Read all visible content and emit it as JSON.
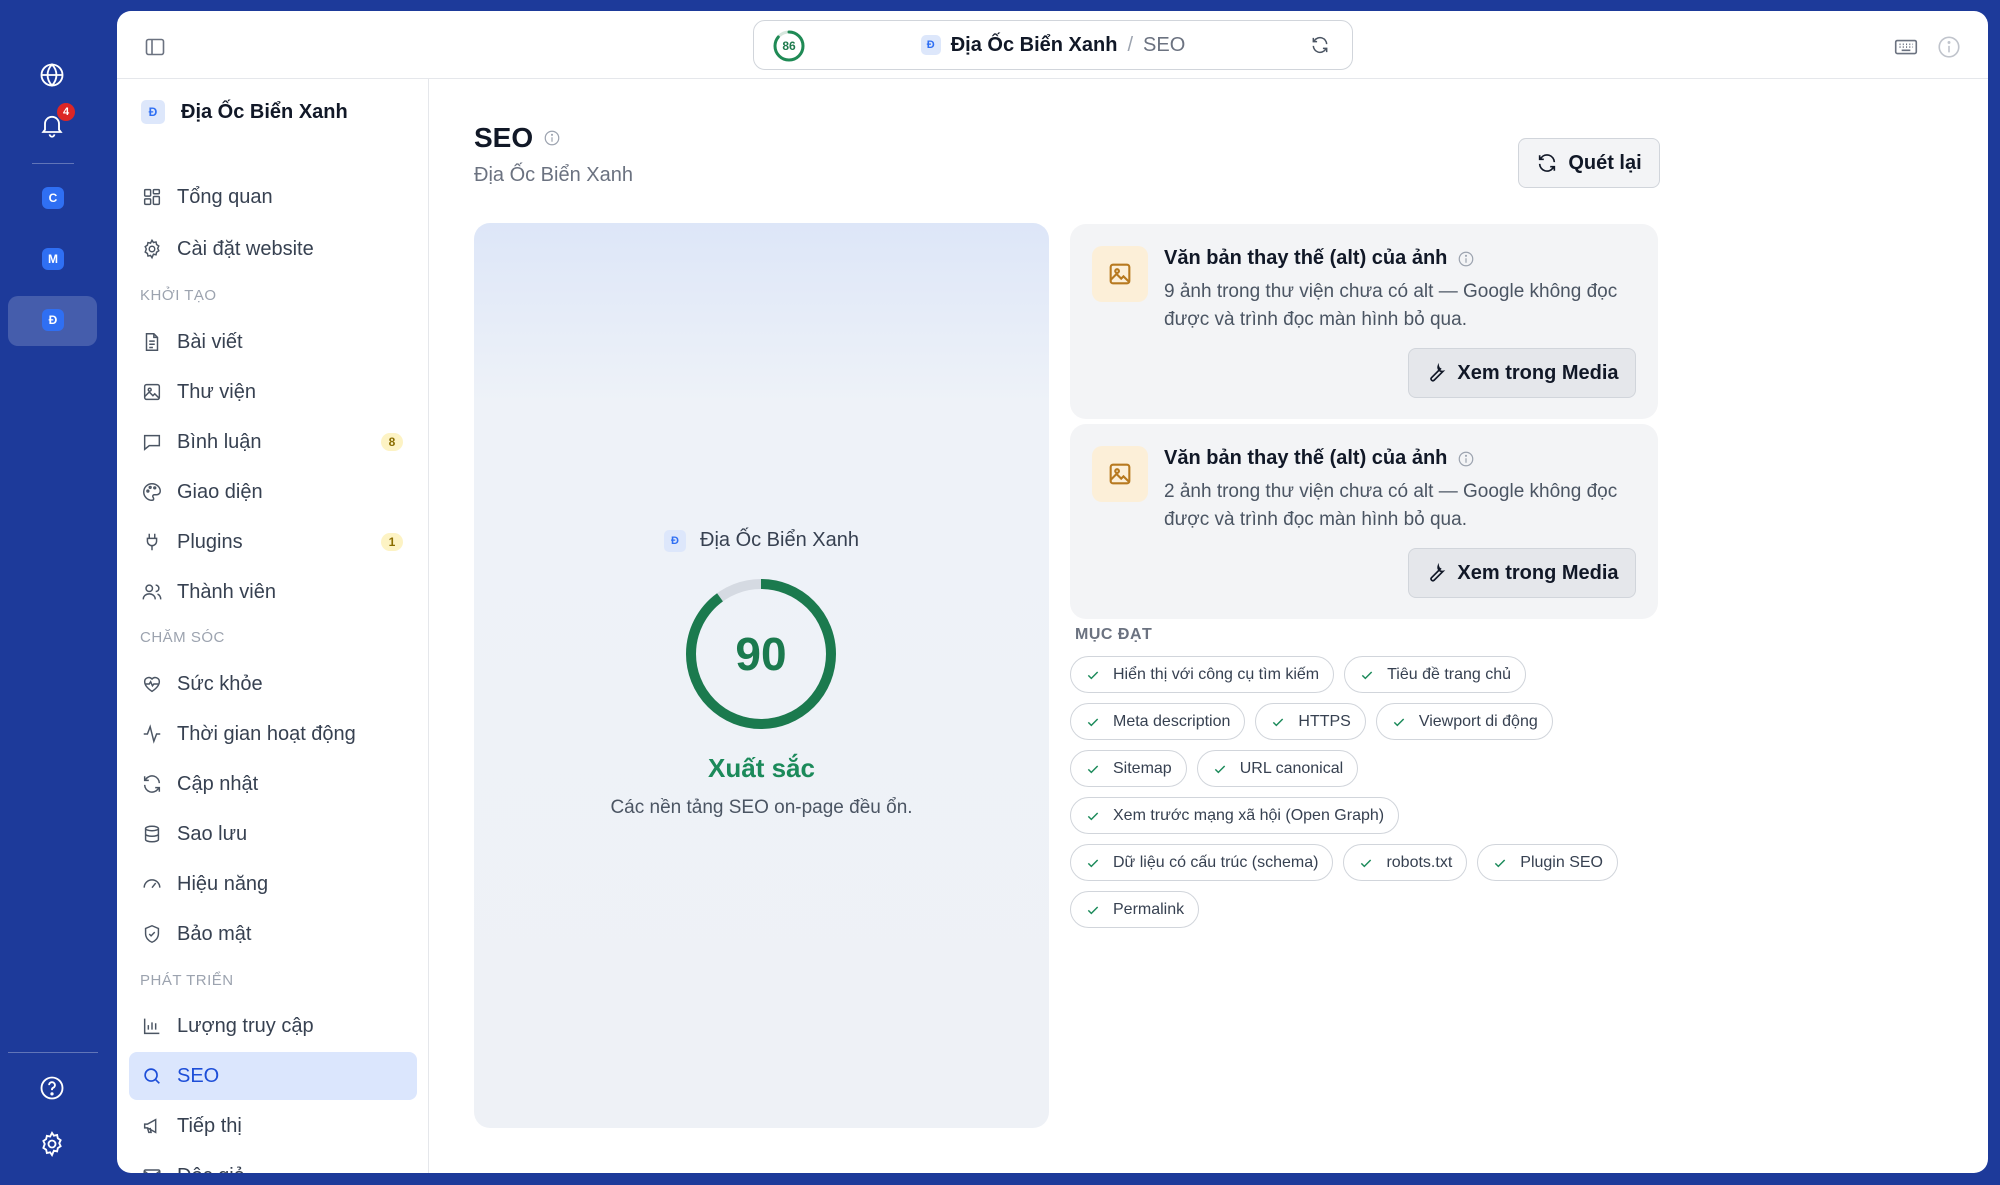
{
  "rail": {
    "notification_count": "4",
    "sites": [
      "C",
      "M",
      "Đ"
    ]
  },
  "address_bar": {
    "score": "86",
    "site_initial": "Đ",
    "site_name": "Địa Ốc Biển Xanh",
    "separator": "/",
    "page": "SEO"
  },
  "sidebar": {
    "site_initial": "Đ",
    "site_name": "Địa Ốc Biển Xanh",
    "top_items": [
      {
        "label": "Tổng quan",
        "icon": "dashboard-icon"
      },
      {
        "label": "Cài đặt website",
        "icon": "gear-icon"
      }
    ],
    "sections": [
      {
        "title": "KHỞI TẠO",
        "items": [
          {
            "label": "Bài viết",
            "icon": "document-icon"
          },
          {
            "label": "Thư viện",
            "icon": "image-icon"
          },
          {
            "label": "Bình luận",
            "icon": "comment-icon",
            "badge": "8"
          },
          {
            "label": "Giao diện",
            "icon": "palette-icon"
          },
          {
            "label": "Plugins",
            "icon": "plug-icon",
            "badge": "1"
          },
          {
            "label": "Thành viên",
            "icon": "users-icon"
          }
        ]
      },
      {
        "title": "CHĂM SÓC",
        "items": [
          {
            "label": "Sức khỏe",
            "icon": "heart-pulse-icon"
          },
          {
            "label": "Thời gian hoạt động",
            "icon": "activity-icon"
          },
          {
            "label": "Cập nhật",
            "icon": "refresh-icon"
          },
          {
            "label": "Sao lưu",
            "icon": "database-icon"
          },
          {
            "label": "Hiệu năng",
            "icon": "gauge-icon"
          },
          {
            "label": "Bảo mật",
            "icon": "shield-icon"
          }
        ]
      },
      {
        "title": "PHÁT TRIỂN",
        "items": [
          {
            "label": "Lượng truy cập",
            "icon": "bar-chart-icon"
          },
          {
            "label": "SEO",
            "icon": "search-icon",
            "active": true
          },
          {
            "label": "Tiếp thị",
            "icon": "megaphone-icon"
          },
          {
            "label": "Độc giả",
            "icon": "mail-icon"
          }
        ]
      }
    ]
  },
  "page": {
    "title": "SEO",
    "subtitle": "Địa Ốc Biển Xanh",
    "rescan_label": "Quét lại"
  },
  "score_card": {
    "site_initial": "Đ",
    "site_name": "Địa Ốc Biển Xanh",
    "score": "90",
    "score_fraction": 0.9,
    "rating": "Xuất sắc",
    "description": "Các nền tảng SEO on-page đều ổn."
  },
  "issues": [
    {
      "title": "Văn bản thay thế (alt) của ảnh",
      "description": "9 ảnh trong thư viện chưa có alt — Google không đọc được và trình đọc màn hình bỏ qua.",
      "button": "Xem trong Media"
    },
    {
      "title": "Văn bản thay thế (alt) của ảnh",
      "description": "2 ảnh trong thư viện chưa có alt — Google không đọc được và trình đọc màn hình bỏ qua.",
      "button": "Xem trong Media"
    }
  ],
  "passed": {
    "title": "MỤC ĐẠT",
    "items": [
      "Hiển thị với công cụ tìm kiếm",
      "Tiêu đề trang chủ",
      "Meta description",
      "HTTPS",
      "Viewport di động",
      "Sitemap",
      "URL canonical",
      "Xem trước mạng xã hội (Open Graph)",
      "Dữ liệu có cấu trúc (schema)",
      "robots.txt",
      "Plugin SEO",
      "Permalink"
    ]
  },
  "colors": {
    "rail_bg": "#1d3a9a",
    "accent": "#2f6ff3",
    "success": "#1b8a5a",
    "warning_icon": "#b7791f"
  }
}
